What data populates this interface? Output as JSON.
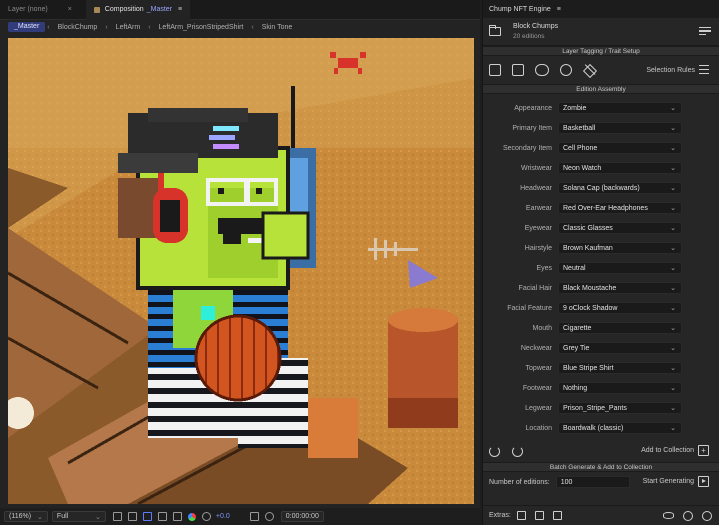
{
  "left": {
    "tabs": {
      "layer": "Layer (none)",
      "composition_prefix": "Composition",
      "composition_name": "_Master"
    },
    "breadcrumbs": [
      "_Master",
      "BlockChump",
      "LeftArm",
      "LeftArm_PrisonStripedShirt",
      "Skin Tone"
    ],
    "status": {
      "zoom": "(116%)",
      "resolution": "Full",
      "exposure": "+0.0",
      "timecode": "0:00:00:00"
    }
  },
  "right": {
    "header": "Chump NFT Engine",
    "project": {
      "name": "Block Chumps",
      "editions": "20 editions"
    },
    "sections": {
      "layer_tagging": "Layer Tagging / Trait Setup",
      "edition_assembly": "Edition Assembly",
      "batch": "Batch Generate & Add to Collection"
    },
    "selection_rules": "Selection Rules",
    "traits": [
      {
        "label": "Appearance",
        "value": "Zombie"
      },
      {
        "label": "Primary Item",
        "value": "Basketball"
      },
      {
        "label": "Secondary Item",
        "value": "Cell Phone"
      },
      {
        "label": "Wristwear",
        "value": "Neon Watch"
      },
      {
        "label": "Headwear",
        "value": "Solana Cap (backwards)"
      },
      {
        "label": "Earwear",
        "value": "Red Over-Ear Headphones"
      },
      {
        "label": "Eyewear",
        "value": "Classic Glasses"
      },
      {
        "label": "Hairstyle",
        "value": "Brown Kaufman"
      },
      {
        "label": "Eyes",
        "value": "Neutral"
      },
      {
        "label": "Facial Hair",
        "value": "Black Moustache"
      },
      {
        "label": "Facial Feature",
        "value": "9 oClock Shadow"
      },
      {
        "label": "Mouth",
        "value": "Cigarette"
      },
      {
        "label": "Neckwear",
        "value": "Grey Tie"
      },
      {
        "label": "Topwear",
        "value": "Blue Stripe Shirt"
      },
      {
        "label": "Footwear",
        "value": "Nothing"
      },
      {
        "label": "Legwear",
        "value": "Prison_Stripe_Pants"
      },
      {
        "label": "Location",
        "value": "Boardwalk (classic)"
      }
    ],
    "add_to_collection": "Add to Collection",
    "num_editions_label": "Number of editions:",
    "num_editions_value": "100",
    "start_generating": "Start Generating",
    "extras_label": "Extras:"
  },
  "colors": {
    "accent": "#9aa6ff",
    "breadcrumb_active": "#333c7a",
    "sand": "#c98a3c",
    "zombie_skin": "#b7e23a",
    "basketball": "#d2541e"
  }
}
